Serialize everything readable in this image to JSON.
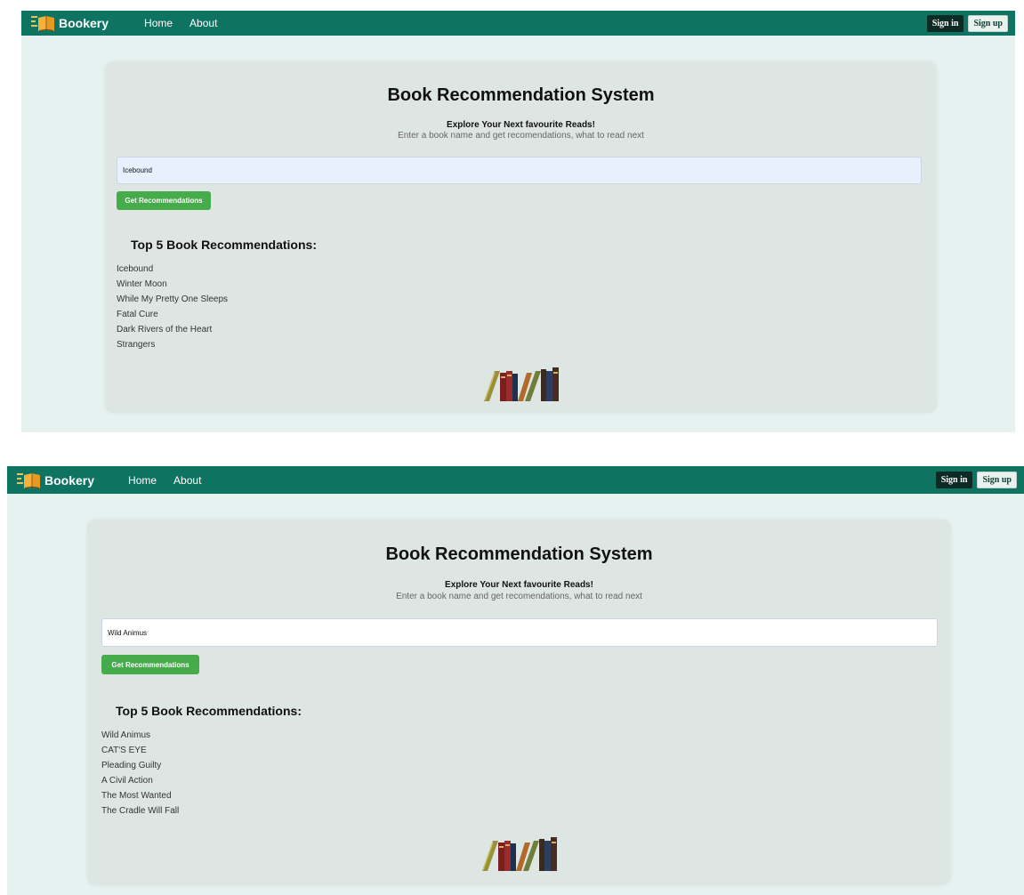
{
  "screenshots": [
    {
      "navbar": {
        "brand": "Bookery",
        "links": [
          "Home",
          "About"
        ],
        "signin_label": "Sign in",
        "signup_label": "Sign up"
      },
      "main": {
        "title": "Book Recommendation System",
        "subtitle": "Explore Your Next favourite Reads!",
        "description": "Enter a book name and get recomendations, what to read next",
        "input_value": "Icebound",
        "button_label": "Get Recommendations",
        "results_heading": "Top 5 Book Recommendations:",
        "results": [
          "Icebound",
          "Winter Moon",
          "While My Pretty One Sleeps",
          "Fatal Cure",
          "Dark Rivers of the Heart",
          "Strangers"
        ]
      }
    },
    {
      "navbar": {
        "brand": "Bookery",
        "links": [
          "Home",
          "About"
        ],
        "signin_label": "Sign in",
        "signup_label": "Sign up"
      },
      "main": {
        "title": "Book Recommendation System",
        "subtitle": "Explore Your Next favourite Reads!",
        "description": "Enter a book name and get recomendations, what to read next",
        "input_value": "Wild Animus",
        "button_label": "Get Recommendations",
        "results_heading": "Top 5 Book Recommendations:",
        "results": [
          "Wild Animus",
          "CAT'S EYE",
          "Pleading Guilty",
          "A Civil Action",
          "The Most Wanted",
          "The Cradle Will Fall"
        ]
      }
    }
  ],
  "colors": {
    "navbar": "#0e7461",
    "page_background": "#e6f2ef",
    "card_background": "#dee6e4",
    "button_green": "#46ac4b",
    "signin_background": "#0c2b24"
  },
  "icons": {
    "brand_logo": "open-book-logo-icon",
    "footer_art": "books-stack-icon"
  }
}
